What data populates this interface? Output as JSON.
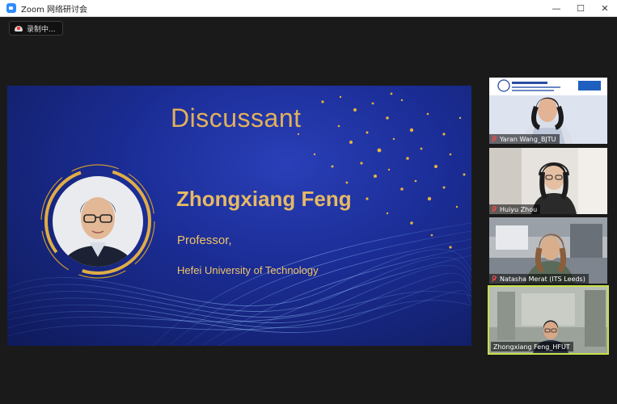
{
  "window": {
    "title": "Zoom 网络研讨会",
    "controls": [
      "—",
      "☐",
      "✕"
    ]
  },
  "recording": {
    "label": "录制中..."
  },
  "slide": {
    "heading": "Discussant",
    "name": "Zhongxiang Feng",
    "role": "Professor,",
    "affiliation": "Hefei University of Technology"
  },
  "participants": [
    {
      "name": "Yaran Wang_BJTU",
      "muted": true,
      "active": false
    },
    {
      "name": "Huiyu Zhou",
      "muted": true,
      "active": false
    },
    {
      "name": "Natasha Merat (ITS Leeds)",
      "muted": true,
      "active": false
    },
    {
      "name": "Zhongxiang Feng_HFUT",
      "muted": false,
      "active": true
    }
  ]
}
